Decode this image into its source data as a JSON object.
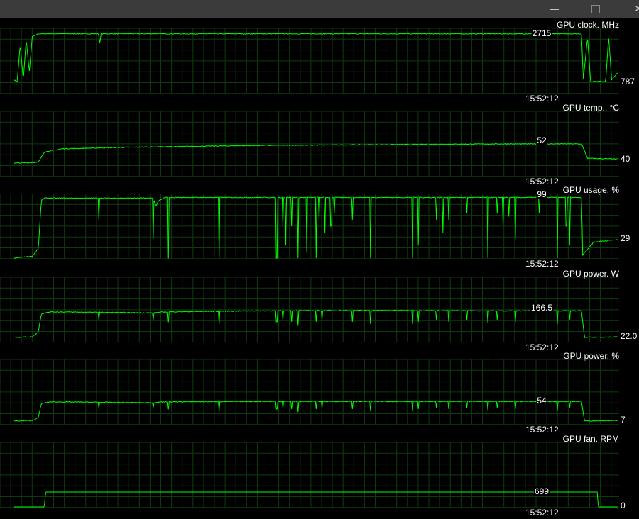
{
  "window": {
    "minimize_icon": "minimize-icon",
    "maximize_icon": "maximize-icon",
    "close_icon": "close-icon"
  },
  "cursor_time": "15:52:12",
  "colors": {
    "line": "#00ff00",
    "grid": "#0f3a0f",
    "cursor": "#e8e040"
  },
  "chart_data": [
    {
      "type": "line",
      "title": "GPU clock, MHz",
      "current": "2715",
      "min_label": "787",
      "ylim": [
        400,
        2900
      ],
      "points": [
        [
          0,
          900
        ],
        [
          0.5,
          850
        ],
        [
          1,
          2300
        ],
        [
          1.5,
          900
        ],
        [
          2,
          2500
        ],
        [
          2.5,
          1200
        ],
        [
          3,
          2600
        ],
        [
          4,
          2715
        ],
        [
          14,
          2715
        ],
        [
          14.2,
          2300
        ],
        [
          14.4,
          2715
        ],
        [
          94,
          2715
        ],
        [
          94.3,
          900
        ],
        [
          95,
          2600
        ],
        [
          95.5,
          850
        ],
        [
          98,
          850
        ],
        [
          98.5,
          2600
        ],
        [
          99,
          900
        ],
        [
          100,
          1200
        ]
      ]
    },
    {
      "type": "line",
      "title": "GPU temp., °C",
      "current": "52",
      "min_label": "40",
      "ylim": [
        30,
        70
      ],
      "points": [
        [
          0,
          38
        ],
        [
          4,
          38.5
        ],
        [
          5,
          45
        ],
        [
          8,
          47
        ],
        [
          20,
          48
        ],
        [
          40,
          49
        ],
        [
          60,
          49.5
        ],
        [
          80,
          50
        ],
        [
          94,
          50
        ],
        [
          95,
          41
        ],
        [
          100,
          40.5
        ]
      ]
    },
    {
      "type": "line",
      "title": "GPU usage, %",
      "current": "99",
      "min_label": "29",
      "ylim": [
        0,
        100
      ],
      "points": [
        [
          0,
          0
        ],
        [
          3,
          3
        ],
        [
          4,
          15
        ],
        [
          4.5,
          90
        ],
        [
          5,
          94
        ],
        [
          23,
          94
        ],
        [
          23.5,
          82
        ],
        [
          24,
          90
        ],
        [
          25,
          95
        ],
        [
          94,
          95
        ],
        [
          94.2,
          5
        ],
        [
          96,
          25
        ],
        [
          100,
          29
        ]
      ],
      "dips": [
        [
          14,
          60
        ],
        [
          23,
          30
        ],
        [
          25.5,
          0
        ],
        [
          34,
          0
        ],
        [
          43.5,
          0
        ],
        [
          44.5,
          50
        ],
        [
          45,
          20
        ],
        [
          46,
          50
        ],
        [
          47,
          0
        ],
        [
          48.5,
          10
        ],
        [
          50,
          0
        ],
        [
          50.5,
          60
        ],
        [
          51.5,
          40
        ],
        [
          52.5,
          50
        ],
        [
          53,
          70
        ],
        [
          56,
          60
        ],
        [
          59,
          0
        ],
        [
          66,
          0
        ],
        [
          67,
          20
        ],
        [
          70,
          60
        ],
        [
          71,
          40
        ],
        [
          72,
          60
        ],
        [
          75,
          70
        ],
        [
          78.5,
          0
        ],
        [
          80,
          70
        ],
        [
          81,
          50
        ],
        [
          82,
          65
        ],
        [
          83,
          30
        ],
        [
          87,
          70
        ],
        [
          90,
          0
        ],
        [
          91.5,
          50
        ],
        [
          92,
          20
        ]
      ]
    },
    {
      "type": "line",
      "title": "GPU power, W",
      "current": "166.5",
      "min_label": "22.0",
      "ylim": [
        0,
        320
      ],
      "points": [
        [
          0,
          22
        ],
        [
          3,
          25
        ],
        [
          4,
          50
        ],
        [
          4.5,
          140
        ],
        [
          6,
          150
        ],
        [
          23,
          145
        ],
        [
          25,
          150
        ],
        [
          40,
          155
        ],
        [
          60,
          157
        ],
        [
          80,
          155
        ],
        [
          94,
          155
        ],
        [
          94.5,
          22
        ],
        [
          100,
          24
        ]
      ],
      "dips": [
        [
          14,
          110
        ],
        [
          23,
          110
        ],
        [
          25.5,
          100
        ],
        [
          34,
          90
        ],
        [
          43.5,
          100
        ],
        [
          44.5,
          110
        ],
        [
          46,
          100
        ],
        [
          47,
          80
        ],
        [
          50,
          100
        ],
        [
          51,
          110
        ],
        [
          56,
          100
        ],
        [
          59,
          90
        ],
        [
          66,
          90
        ],
        [
          67,
          100
        ],
        [
          70,
          110
        ],
        [
          72,
          100
        ],
        [
          75,
          110
        ],
        [
          78.5,
          95
        ],
        [
          80,
          110
        ],
        [
          83,
          100
        ],
        [
          90,
          90
        ],
        [
          92,
          110
        ]
      ]
    },
    {
      "type": "line",
      "title": "GPU power, %",
      "current": "54",
      "min_label": "7",
      "ylim": [
        0,
        150
      ],
      "points": [
        [
          0,
          7
        ],
        [
          3,
          8
        ],
        [
          4,
          15
        ],
        [
          4.5,
          48
        ],
        [
          6,
          52
        ],
        [
          23,
          50
        ],
        [
          25,
          52
        ],
        [
          40,
          53
        ],
        [
          60,
          53
        ],
        [
          80,
          53
        ],
        [
          94,
          53
        ],
        [
          94.5,
          7
        ],
        [
          100,
          8
        ]
      ],
      "dips": [
        [
          14,
          38
        ],
        [
          23,
          38
        ],
        [
          25.5,
          35
        ],
        [
          34,
          32
        ],
        [
          43.5,
          35
        ],
        [
          44.5,
          38
        ],
        [
          46,
          35
        ],
        [
          47,
          28
        ],
        [
          50,
          35
        ],
        [
          51,
          38
        ],
        [
          56,
          35
        ],
        [
          59,
          32
        ],
        [
          66,
          32
        ],
        [
          67,
          35
        ],
        [
          70,
          38
        ],
        [
          72,
          35
        ],
        [
          75,
          38
        ],
        [
          78.5,
          33
        ],
        [
          80,
          38
        ],
        [
          83,
          35
        ],
        [
          90,
          32
        ],
        [
          92,
          38
        ]
      ]
    },
    {
      "type": "line",
      "title": "GPU fan, RPM",
      "current": "699",
      "min_label": "0",
      "ylim": [
        0,
        3000
      ],
      "points": [
        [
          0,
          0
        ],
        [
          5,
          0
        ],
        [
          5.2,
          699
        ],
        [
          96.6,
          699
        ],
        [
          96.8,
          0
        ],
        [
          100,
          0
        ]
      ]
    }
  ]
}
